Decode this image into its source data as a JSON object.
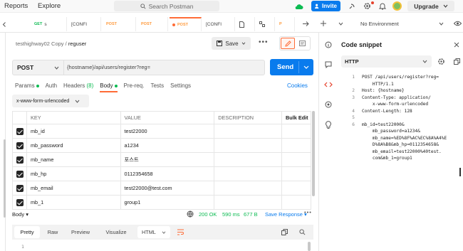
{
  "topbar": {
    "nav": [
      "Reports",
      "Explore"
    ],
    "search_placeholder": "Search Postman",
    "invite": "Invite",
    "upgrade": "Upgrade"
  },
  "tabs": [
    {
      "method": "GET",
      "label": "s",
      "active": false
    },
    {
      "method": "",
      "label": "[CONFI",
      "active": false
    },
    {
      "method": "POST",
      "label": "",
      "active": false
    },
    {
      "method": "POST",
      "label": "",
      "active": false
    },
    {
      "method": "POST",
      "label": "",
      "active": true
    },
    {
      "method": "",
      "label": "[CONFI",
      "active": false
    }
  ],
  "environment": "No Environment",
  "breadcrumb": {
    "collection": "testhighway02 Copy",
    "request": "reguser"
  },
  "save_label": "Save",
  "request": {
    "method": "POST",
    "url": "{hostname}/api/users/register?reg=",
    "send": "Send"
  },
  "request_tabs": {
    "params": "Params",
    "auth": "Auth",
    "headers": "Headers",
    "headers_count": "(8)",
    "body": "Body",
    "prereq": "Pre-req.",
    "tests": "Tests",
    "settings": "Settings",
    "cookies": "Cookies"
  },
  "body_type": "x-www-form-urlencoded",
  "table": {
    "headers": {
      "key": "KEY",
      "value": "VALUE",
      "description": "DESCRIPTION",
      "bulk": "Bulk Edit"
    },
    "rows": [
      {
        "key": "mb_id",
        "value": "test22000"
      },
      {
        "key": "mb_password",
        "value": "a1234"
      },
      {
        "key": "mb_name",
        "value": "포스트"
      },
      {
        "key": "mb_hp",
        "value": "0112354658"
      },
      {
        "key": "mb_email",
        "value": "test22000@test.com"
      },
      {
        "key": "mb_1",
        "value": "group1"
      }
    ]
  },
  "response": {
    "label": "Body",
    "status": "200 OK",
    "time": "590 ms",
    "size": "677 B",
    "save": "Save Response",
    "tabs": [
      "Pretty",
      "Raw",
      "Preview",
      "Visualize"
    ],
    "format": "HTML",
    "line1": "1"
  },
  "snippet": {
    "title": "Code snippet",
    "language": "HTTP",
    "lines": [
      {
        "n": "1",
        "text": "POST /api/users/register?reg=\n    HTTP/1.1"
      },
      {
        "n": "2",
        "text": "Host: {hostname}"
      },
      {
        "n": "3",
        "text": "Content-Type: application/\n    x-www-form-urlencoded"
      },
      {
        "n": "4",
        "text": "Content-Length: 128"
      },
      {
        "n": "5",
        "text": ""
      },
      {
        "n": "6",
        "text": "mb_id=test22000&\n    mb_password=a1234&\n    mb_name=%ED%8F%AC%EC%8A%A4%E\n    D%8A%B8&mb_hp=0112354658&\n    mb_email=test22000%40test.\n    com&mb_1=group1"
      }
    ]
  },
  "colors": {
    "accent": "#ff6c37",
    "primary": "#097bed",
    "success": "#0cbb52"
  }
}
